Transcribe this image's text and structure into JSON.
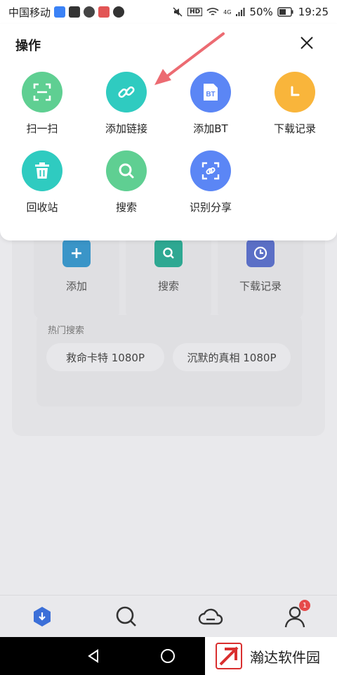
{
  "status_bar": {
    "carrier": "中国移动",
    "network": "4G",
    "battery": "50%",
    "time": "19:25"
  },
  "sheet": {
    "title": "操作",
    "actions": [
      {
        "label": "扫一扫",
        "icon": "scan-icon",
        "color": "#5fcf92"
      },
      {
        "label": "添加链接",
        "icon": "link-icon",
        "color": "#2fcbc0"
      },
      {
        "label": "添加BT",
        "icon": "bt-icon",
        "color": "#5b86f5",
        "icon_text": "BT"
      },
      {
        "label": "下载记录",
        "icon": "clock-icon",
        "color": "#f9b53b"
      },
      {
        "label": "回收站",
        "icon": "trash-icon",
        "color": "#2fcbc0"
      },
      {
        "label": "搜索",
        "icon": "search-icon",
        "color": "#5fcf92"
      },
      {
        "label": "识别分享",
        "icon": "recognize-share-icon",
        "color": "#5b86f5"
      }
    ]
  },
  "background": {
    "quick_actions": [
      {
        "label": "添加",
        "icon": "plus-icon",
        "color": "#3a95c8"
      },
      {
        "label": "搜索",
        "icon": "search-icon",
        "color": "#2ea892"
      },
      {
        "label": "下载记录",
        "icon": "clock-icon",
        "color": "#5b6fc6"
      }
    ],
    "hot_search_title": "热门搜索",
    "hot_search_chips": [
      "救命卡特 1080P",
      "沉默的真相 1080P"
    ]
  },
  "bottom_nav": {
    "items": [
      {
        "name": "download-tab",
        "icon": "download-icon"
      },
      {
        "name": "search-tab",
        "icon": "search-icon"
      },
      {
        "name": "cloud-tab",
        "icon": "cloud-icon"
      },
      {
        "name": "profile-tab",
        "icon": "person-icon"
      }
    ],
    "profile_badge": "1"
  },
  "watermark": {
    "text": "瀚达软件园"
  }
}
